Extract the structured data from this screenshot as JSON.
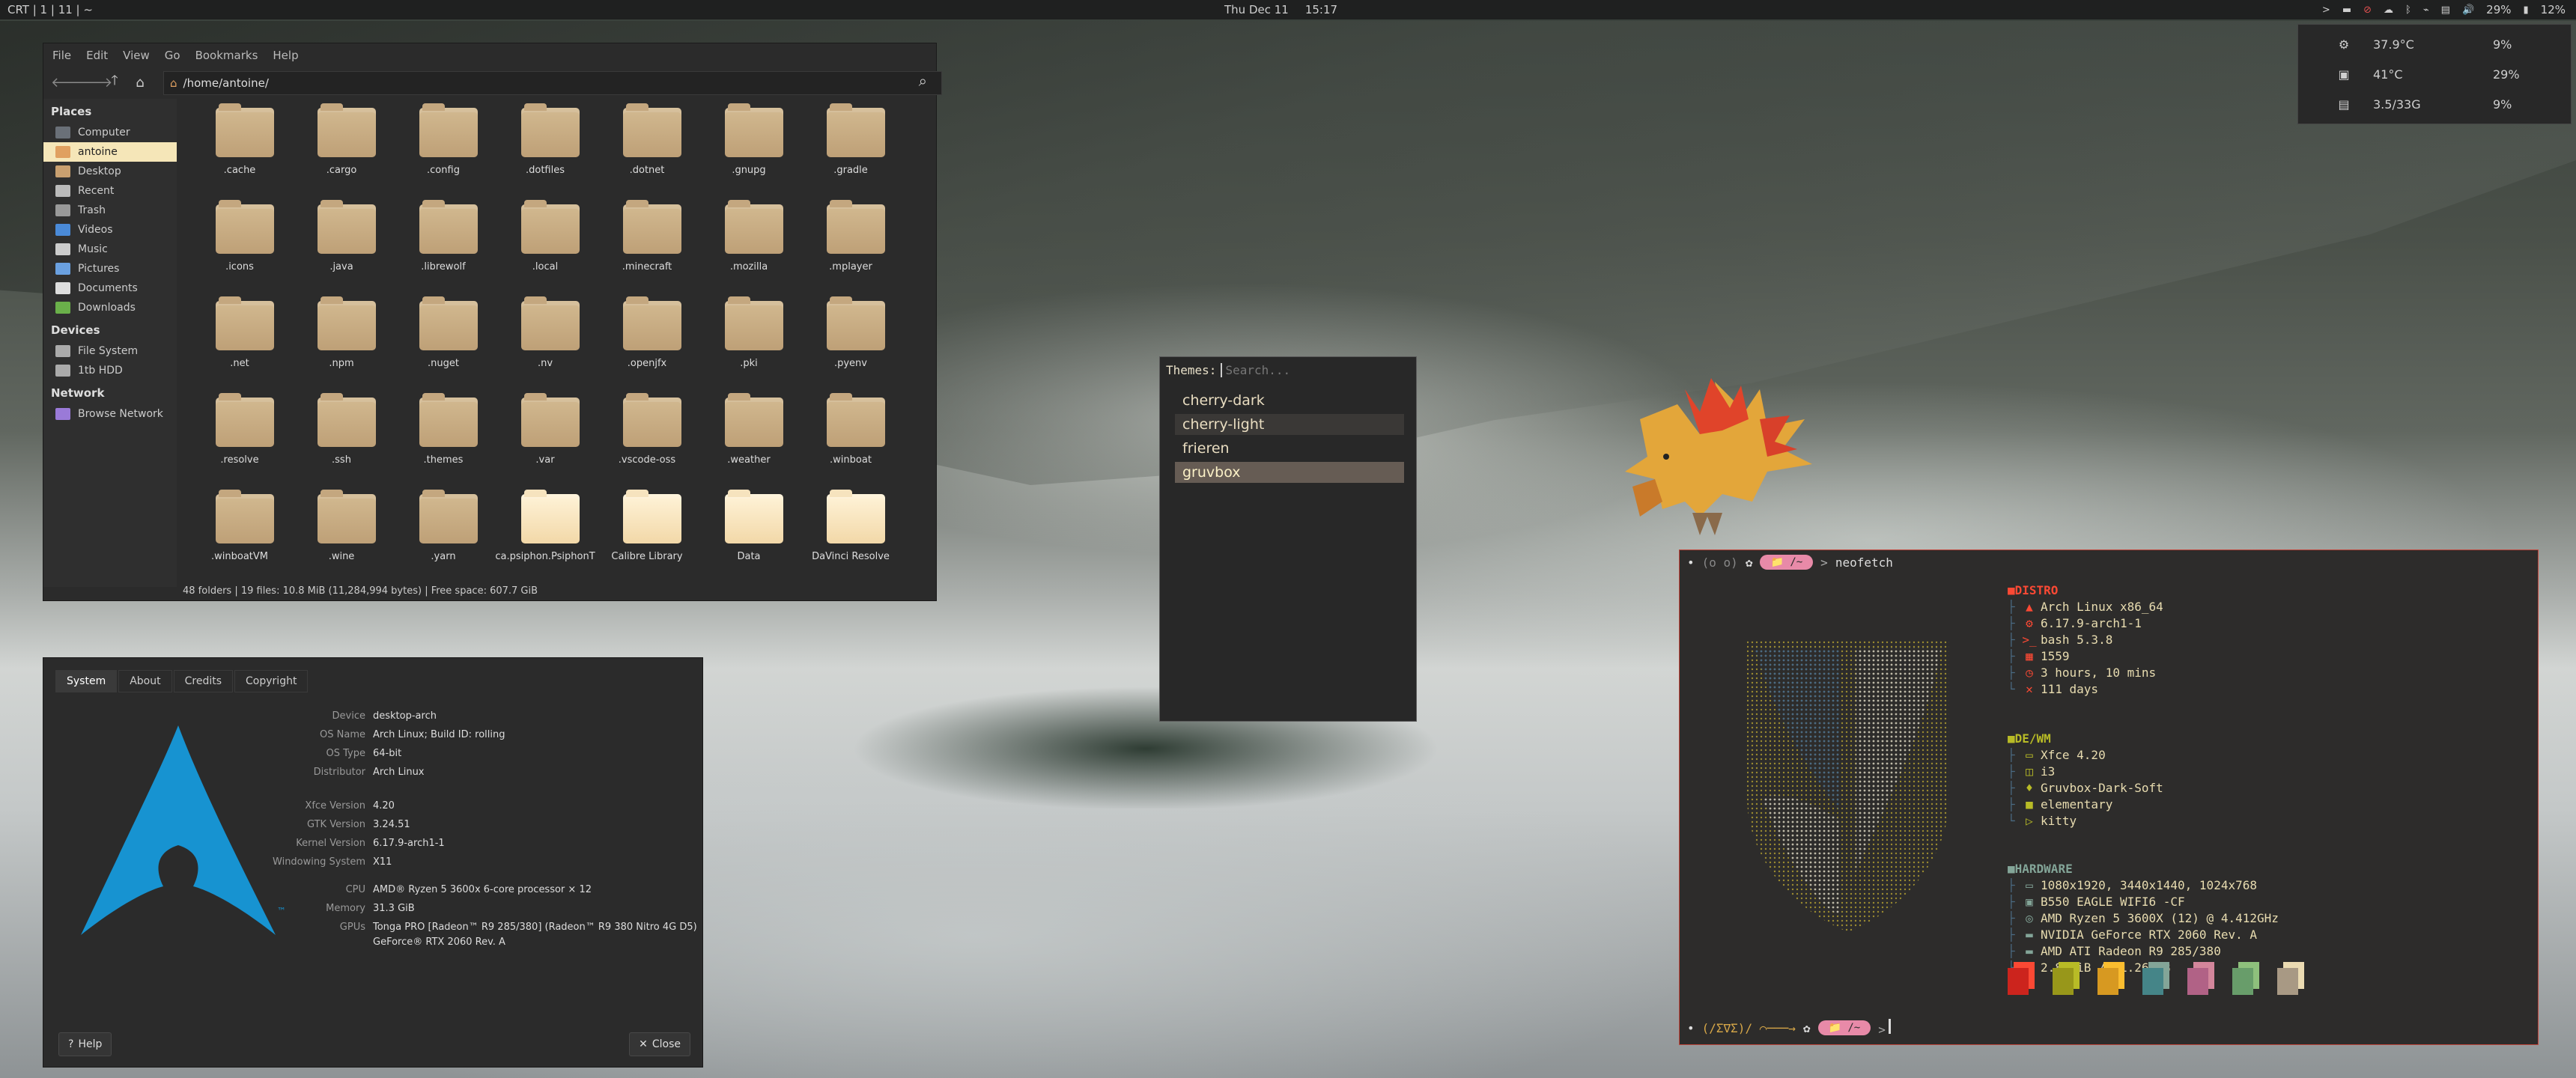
{
  "colors": {
    "topbar_bg": "#1f2020",
    "window_bg": "#2b2b2b",
    "terminal_border": "#c0463c",
    "arch_blue": "#1793d1",
    "pill": "#e88aa8",
    "selected_theme": "#665c54"
  },
  "topbar": {
    "workspaces": "CRT | 1 | 11 | ~",
    "date": "Thu Dec 11",
    "time": "15:17",
    "arrow": ">",
    "volume": "29%",
    "battery": "12%"
  },
  "stats": [
    {
      "icon": "cpu-icon",
      "glyph": "⚙",
      "temp": "37.9°C",
      "usage": "9%"
    },
    {
      "icon": "gpu-icon",
      "glyph": "▣",
      "temp": "41°C",
      "usage": "29%"
    },
    {
      "icon": "ram-icon",
      "glyph": "▤",
      "temp": "3.5/33G",
      "usage": "9%"
    }
  ],
  "file_manager": {
    "menu": [
      "File",
      "Edit",
      "View",
      "Go",
      "Bookmarks",
      "Help"
    ],
    "path": "/home/antoine/",
    "sidebar": {
      "places_header": "Places",
      "places": [
        {
          "label": "Computer",
          "icon": "computer-icon",
          "color": "#6a7078"
        },
        {
          "label": "antoine",
          "icon": "home-icon",
          "color": "#e0a060",
          "selected": true
        },
        {
          "label": "Desktop",
          "icon": "desktop-icon",
          "color": "#c9a070"
        },
        {
          "label": "Recent",
          "icon": "recent-icon",
          "color": "#bbbbbb"
        },
        {
          "label": "Trash",
          "icon": "trash-icon",
          "color": "#999999"
        },
        {
          "label": "Videos",
          "icon": "videos-icon",
          "color": "#4a8ad8"
        },
        {
          "label": "Music",
          "icon": "music-icon",
          "color": "#cccccc"
        },
        {
          "label": "Pictures",
          "icon": "pictures-icon",
          "color": "#6aa0e0"
        },
        {
          "label": "Documents",
          "icon": "documents-icon",
          "color": "#dddddd"
        },
        {
          "label": "Downloads",
          "icon": "downloads-icon",
          "color": "#6ab04a"
        }
      ],
      "devices_header": "Devices",
      "devices": [
        {
          "label": "File System",
          "icon": "drive-icon",
          "color": "#aaaaaa"
        },
        {
          "label": "1tb HDD",
          "icon": "drive-icon",
          "color": "#aaaaaa"
        }
      ],
      "network_header": "Network",
      "network": [
        {
          "label": "Browse Network",
          "icon": "network-icon",
          "color": "#9a7ad8"
        }
      ]
    },
    "folders": [
      {
        "name": ".cache"
      },
      {
        "name": ".cargo"
      },
      {
        "name": ".config"
      },
      {
        "name": ".dotfiles"
      },
      {
        "name": ".dotnet"
      },
      {
        "name": ".gnupg"
      },
      {
        "name": ".gradle"
      },
      {
        "name": ".icons"
      },
      {
        "name": ".java"
      },
      {
        "name": ".librewolf"
      },
      {
        "name": ".local"
      },
      {
        "name": ".minecraft"
      },
      {
        "name": ".mozilla"
      },
      {
        "name": ".mplayer"
      },
      {
        "name": ".net"
      },
      {
        "name": ".npm"
      },
      {
        "name": ".nuget"
      },
      {
        "name": ".nv"
      },
      {
        "name": ".openjfx"
      },
      {
        "name": ".pki"
      },
      {
        "name": ".pyenv"
      },
      {
        "name": ".resolve"
      },
      {
        "name": ".ssh"
      },
      {
        "name": ".themes"
      },
      {
        "name": ".var"
      },
      {
        "name": ".vscode-oss"
      },
      {
        "name": ".weather"
      },
      {
        "name": ".winboat"
      },
      {
        "name": ".winboatVM"
      },
      {
        "name": ".wine"
      },
      {
        "name": ".yarn"
      },
      {
        "name": "ca.psiphon.PsiphonT",
        "lite": true
      },
      {
        "name": "Calibre Library",
        "lite": true
      },
      {
        "name": "Data",
        "lite": true
      },
      {
        "name": "DaVinci Resolve",
        "lite": true
      }
    ],
    "status": "48 folders  |  19 files: 10.8 MiB (11,284,994 bytes)  |  Free space: 607.7 GiB"
  },
  "about": {
    "tabs": [
      "System",
      "About",
      "Credits",
      "Copyright"
    ],
    "rows": [
      {
        "key": "Device",
        "value": "desktop-arch"
      },
      {
        "key": "OS Name",
        "value": "Arch Linux; Build ID: rolling"
      },
      {
        "key": "OS Type",
        "value": "64-bit"
      },
      {
        "key": "Distributor",
        "value": "Arch Linux"
      },
      {
        "key": "Xfce Version",
        "value": "4.20"
      },
      {
        "key": "GTK Version",
        "value": "3.24.51"
      },
      {
        "key": "Kernel Version",
        "value": "6.17.9-arch1-1"
      },
      {
        "key": "Windowing System",
        "value": "X11"
      },
      {
        "key": "CPU",
        "value": "AMD® Ryzen 5 3600x 6-core processor × 12"
      },
      {
        "key": "Memory",
        "value": "31.3 GiB"
      },
      {
        "key": "GPUs",
        "value": "Tonga PRO [Radeon™ R9 285/380] (Radeon™ R9 380 Nitro 4G D5)"
      }
    ],
    "gpu_line2": "GeForce® RTX 2060 Rev. A",
    "logo_tm": "™",
    "help_label": "Help",
    "close_label": "Close"
  },
  "themes": {
    "label": "Themes:",
    "placeholder": "Search...",
    "items": [
      "cherry-dark",
      "cherry-light",
      "frieren",
      "gruvbox"
    ],
    "selected": "gruvbox"
  },
  "terminal": {
    "prompt_left": "(o o)",
    "prompt_star": "✿",
    "prompt_dir": "📁 /~",
    "command": "neofetch",
    "bottom_left": "(/Σ∇Σ)/ ⌒───→",
    "distro_header": "DISTRO",
    "distro": [
      {
        "icon": "arch-icon",
        "glyph": "▲",
        "color": "#fb4934",
        "value": "Arch Linux x86_64"
      },
      {
        "icon": "kernel-icon",
        "glyph": "⚙",
        "color": "#fb4934",
        "value": "6.17.9-arch1-1"
      },
      {
        "icon": "shell-icon",
        "glyph": ">_",
        "color": "#fb4934",
        "value": "bash 5.3.8"
      },
      {
        "icon": "package-icon",
        "glyph": "▦",
        "color": "#fb4934",
        "value": "1559"
      },
      {
        "icon": "clock-icon",
        "glyph": "◷",
        "color": "#fb4934",
        "value": "3 hours, 10 mins"
      },
      {
        "icon": "wrench-icon",
        "glyph": "✕",
        "color": "#fb4934",
        "value": "111 days"
      }
    ],
    "de_header": "DE/WM",
    "de": [
      {
        "icon": "monitor-icon",
        "glyph": "▭",
        "color": "#b8bb26",
        "value": "Xfce 4.20"
      },
      {
        "icon": "window-icon",
        "glyph": "◫",
        "color": "#b8bb26",
        "value": "i3"
      },
      {
        "icon": "brush-icon",
        "glyph": "♦",
        "color": "#b8bb26",
        "value": "Gruvbox-Dark-Soft"
      },
      {
        "icon": "folder-icon",
        "glyph": "■",
        "color": "#b8bb26",
        "value": "elementary"
      },
      {
        "icon": "terminal-icon",
        "glyph": "▷",
        "color": "#b8bb26",
        "value": "kitty"
      }
    ],
    "hw_header": "HARDWARE",
    "hw": [
      {
        "icon": "display-icon",
        "glyph": "▭",
        "color": "#83a598",
        "value": "1080x1920, 3440x1440, 1024x768"
      },
      {
        "icon": "board-icon",
        "glyph": "▣",
        "color": "#83a598",
        "value": "B550 EAGLE WIFI6 -CF"
      },
      {
        "icon": "cpu-icon",
        "glyph": "◎",
        "color": "#83a598",
        "value": "AMD Ryzen 5 3600X (12) @ 4.412GHz"
      },
      {
        "icon": "gpu-icon",
        "glyph": "▬",
        "color": "#83a598",
        "value": "NVIDIA GeForce RTX 2060 Rev. A"
      },
      {
        "icon": "gpu-icon",
        "glyph": "▬",
        "color": "#83a598",
        "value": "AMD ATI Radeon R9 285/380"
      },
      {
        "icon": "memory-icon",
        "glyph": "◔",
        "color": "#83a598",
        "value": "2.85GiB / 31.26GiB"
      }
    ],
    "swatches": [
      {
        "dark": "#cc241d",
        "light": "#fb4934"
      },
      {
        "dark": "#98971a",
        "light": "#b8bb26"
      },
      {
        "dark": "#d79921",
        "light": "#fabd2f"
      },
      {
        "dark": "#458588",
        "light": "#83a598"
      },
      {
        "dark": "#b16286",
        "light": "#d3869b"
      },
      {
        "dark": "#689d6a",
        "light": "#8ec07c"
      },
      {
        "dark": "#a89984",
        "light": "#ebdbb2"
      }
    ]
  }
}
